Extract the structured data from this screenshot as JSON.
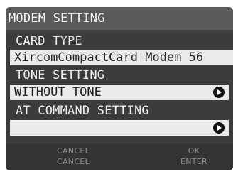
{
  "title": "MODEM SETTING",
  "card_type": {
    "label": "CARD TYPE",
    "value": "XircomCompactCard Modem 56"
  },
  "tone_setting": {
    "label": "TONE SETTING",
    "value": "WITHOUT TONE"
  },
  "at_command_setting": {
    "label": "AT COMMAND SETTING",
    "value": ""
  },
  "buttons": {
    "cancel_top": "CANCEL",
    "cancel_bottom": "CANCEL",
    "ok": "OK",
    "enter": "ENTER"
  }
}
